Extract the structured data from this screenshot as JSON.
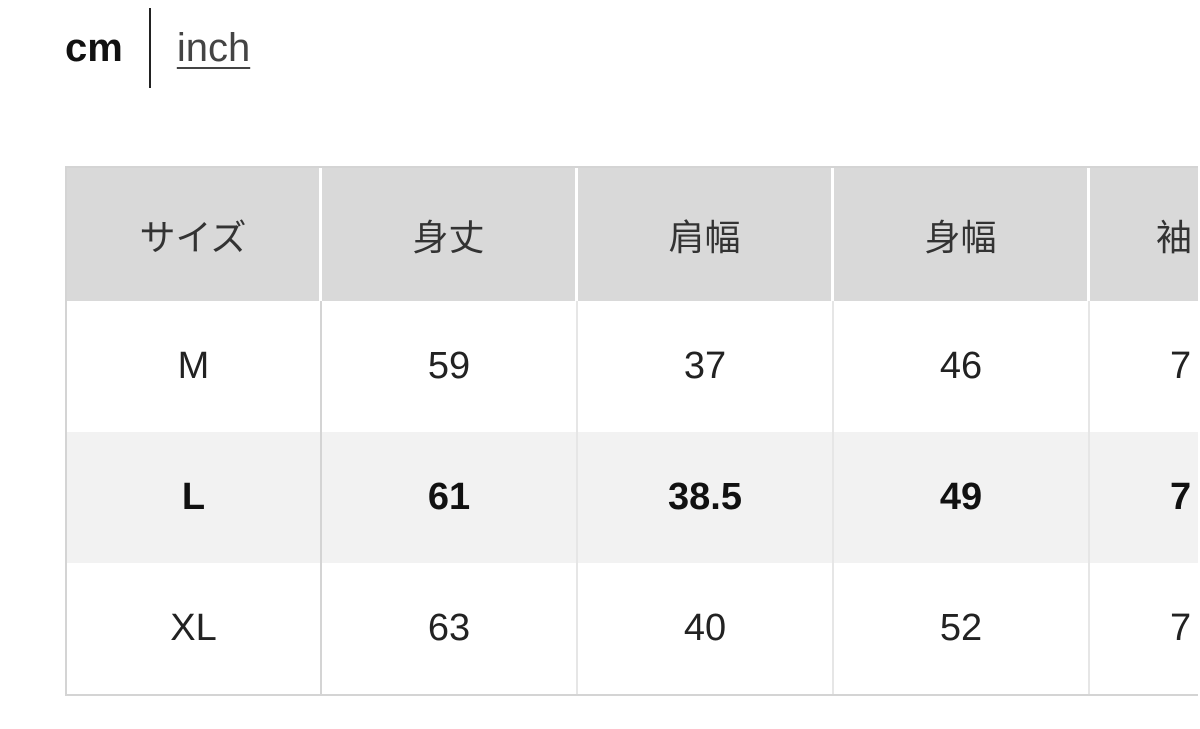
{
  "units": {
    "cm": "cm",
    "inch": "inch",
    "selected": "cm"
  },
  "table": {
    "headers": [
      "サイズ",
      "身丈",
      "肩幅",
      "身幅",
      "袖"
    ],
    "rows": [
      {
        "cells": [
          "M",
          "59",
          "37",
          "46",
          "7"
        ],
        "highlight": false
      },
      {
        "cells": [
          "L",
          "61",
          "38.5",
          "49",
          "7"
        ],
        "highlight": true
      },
      {
        "cells": [
          "XL",
          "63",
          "40",
          "52",
          "7"
        ],
        "highlight": false
      }
    ]
  },
  "colors": {
    "header_bg": "#d9d9d9",
    "highlight_row_bg": "#f2f2f2",
    "border": "#d4d4d4"
  }
}
